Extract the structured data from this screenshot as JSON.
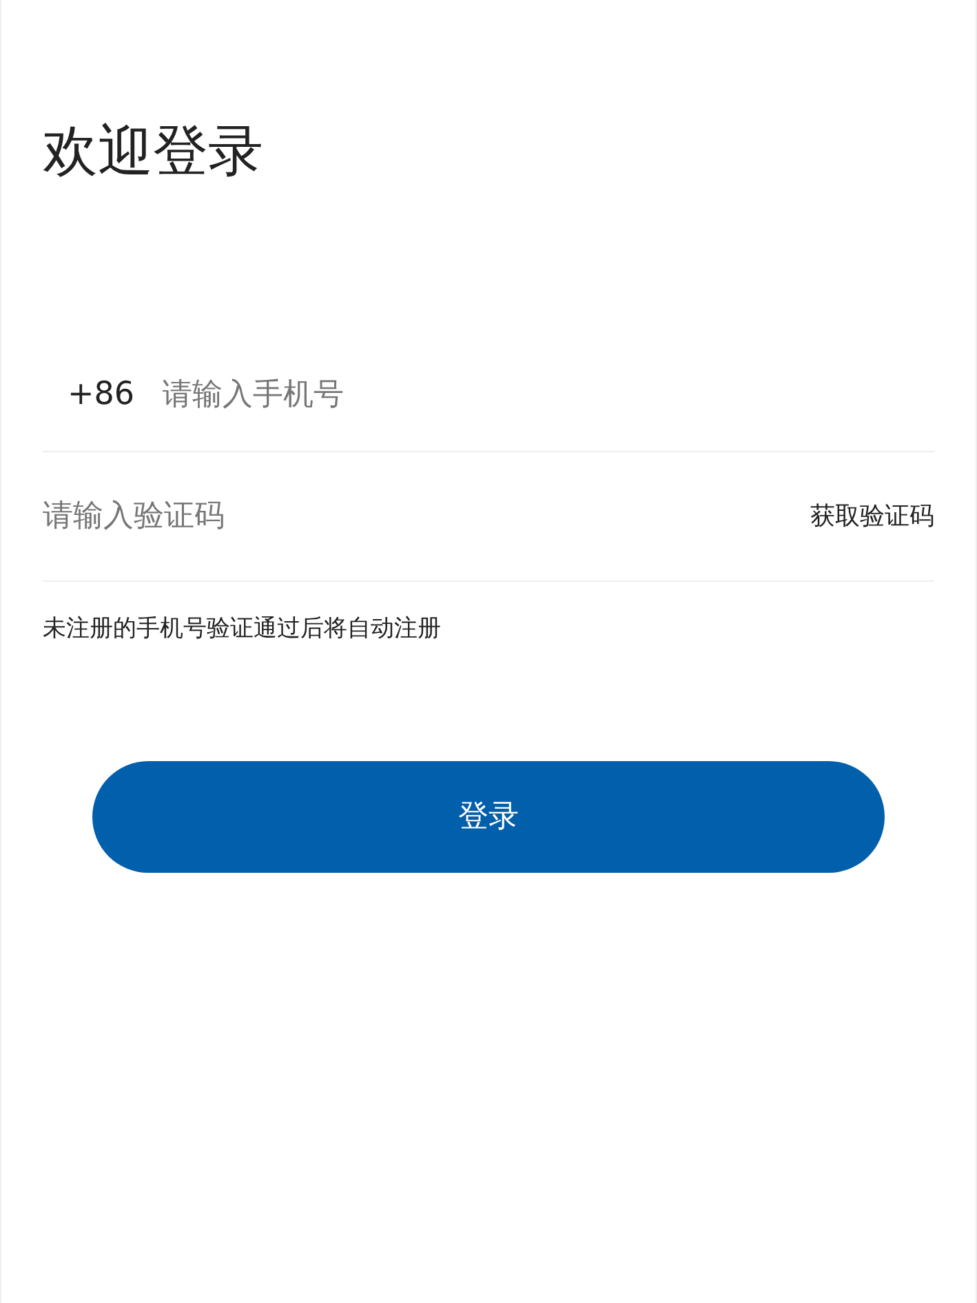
{
  "title": "欢迎登录",
  "phone": {
    "prefix": "+86",
    "placeholder": "请输入手机号"
  },
  "code": {
    "placeholder": "请输入验证码",
    "button": "获取验证码"
  },
  "note": "未注册的手机号验证通过后将自动注册",
  "login_button": "登录"
}
